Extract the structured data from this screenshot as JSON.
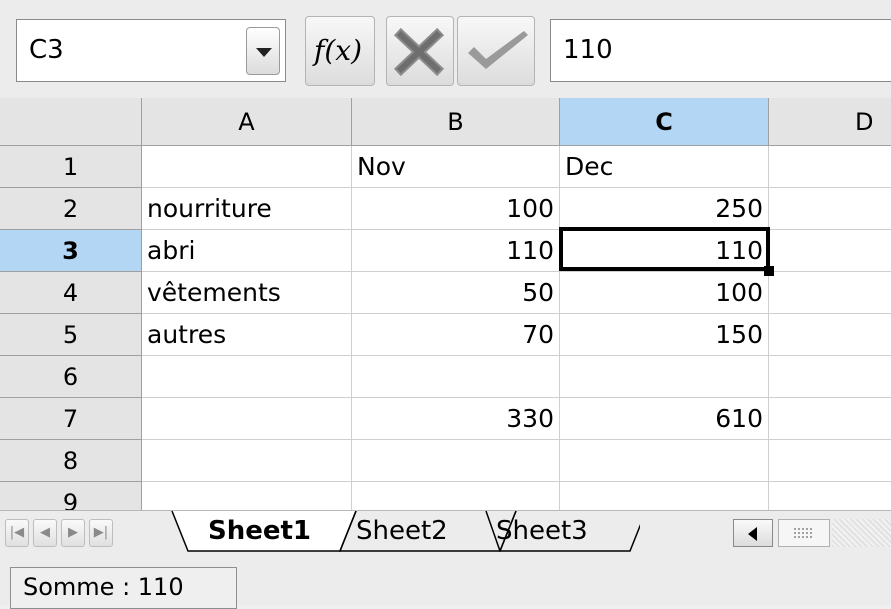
{
  "toolbar": {
    "name_box": "C3",
    "formula_value": "110",
    "fx_label": "f(x)"
  },
  "grid": {
    "columns": [
      "A",
      "B",
      "C",
      "D"
    ],
    "rows": [
      "1",
      "2",
      "3",
      "4",
      "5",
      "6",
      "7",
      "8",
      "9"
    ],
    "selected_column": "C",
    "selected_row": "3",
    "cells": {
      "B1": "Nov",
      "C1": "Dec",
      "A2": "nourriture",
      "B2": "100",
      "C2": "250",
      "A3": "abri",
      "B3": "110",
      "C3": "110",
      "A4": "vêtements",
      "B4": "50",
      "C4": "100",
      "A5": "autres",
      "B5": "70",
      "C5": "150",
      "B7": "330",
      "C7": "610"
    }
  },
  "tabs": [
    "Sheet1",
    "Sheet2",
    "Sheet3"
  ],
  "active_tab": "Sheet1",
  "status": {
    "sum": "Somme : 110"
  },
  "colors": {
    "selection_header": "#b3d6f5",
    "header_bg": "#e4e4e4",
    "grid_line": "#cfcfcf"
  }
}
